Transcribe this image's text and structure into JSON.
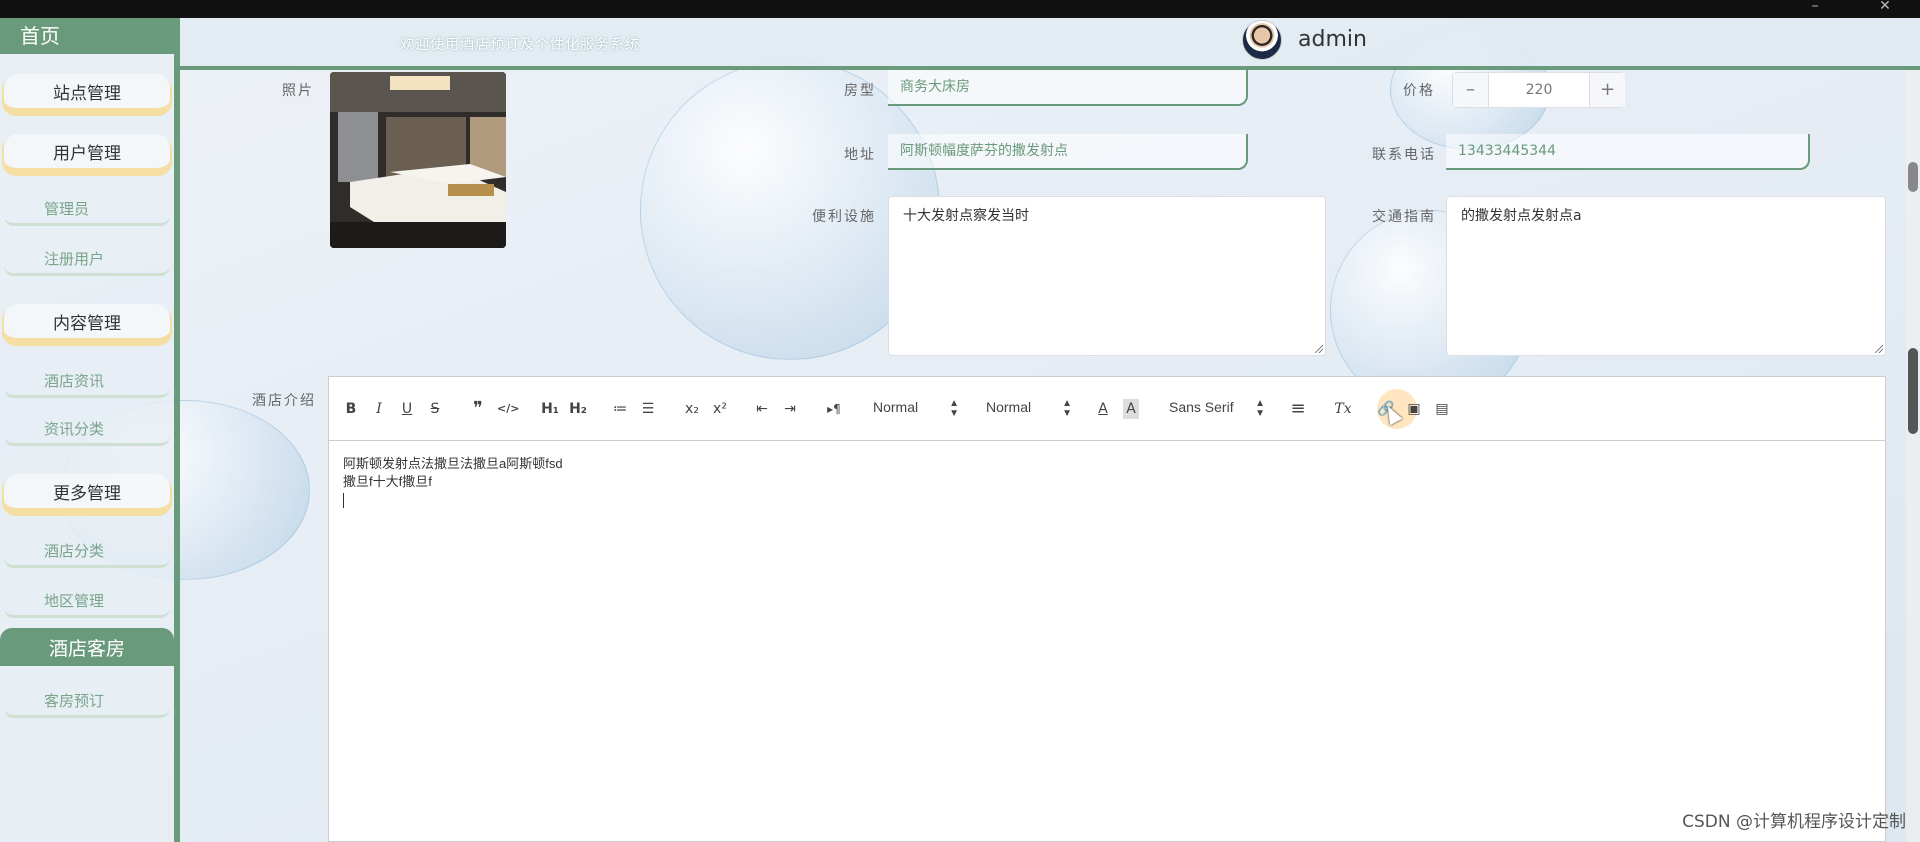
{
  "window": {
    "minimize_label": "–",
    "close_label": "✕"
  },
  "header": {
    "welcome": "欢迎使用酒店预订及个性化服务系统",
    "username": "admin",
    "avatar_icon": "user-avatar"
  },
  "sidebar": {
    "home": "首页",
    "groups": [
      {
        "title": "站点管理",
        "items": []
      },
      {
        "title": "用户管理",
        "items": [
          "管理员",
          "注册用户"
        ]
      },
      {
        "title": "内容管理",
        "items": [
          "酒店资讯",
          "资讯分类"
        ]
      },
      {
        "title": "更多管理",
        "items": [
          "酒店分类",
          "地区管理"
        ]
      }
    ],
    "active_group": {
      "title": "酒店客房",
      "items": [
        "客房预订"
      ]
    }
  },
  "form": {
    "photo_label": "照片",
    "room_type_label": "房型",
    "room_type_value": "商务大床房",
    "price_label": "价格",
    "price_value": "220",
    "address_label": "地址",
    "address_value": "阿斯顿幅度萨芬的撒发射点",
    "phone_label": "联系电话",
    "phone_value": "13433445344",
    "facilities_label": "便利设施",
    "facilities_value": "十大发射点察发当时",
    "transport_label": "交通指南",
    "transport_value": "的撒发射点发射点a",
    "intro_label": "酒店介绍"
  },
  "editor": {
    "toolbar": {
      "bold": "B",
      "italic": "I",
      "underline": "U",
      "strike": "S",
      "blockquote": "❞",
      "code": "</>",
      "h1": "H₁",
      "h2": "H₂",
      "ordered_list": "≔",
      "bullet_list": "☰",
      "subscript": "x₂",
      "superscript": "x²",
      "outdent": "⇤",
      "indent": "⇥",
      "direction": "▸¶",
      "size_select": "Normal",
      "header_select": "Normal",
      "font_select": "Sans Serif",
      "color": "A",
      "background": "A",
      "align": "≡",
      "clean": "Tx"
    },
    "content_lines": [
      "阿斯顿发射点法撒旦法撒旦a阿斯顿fsd",
      "撒旦f十大f撒旦f"
    ]
  },
  "watermark": "CSDN @计算机程序设计定制",
  "colors": {
    "accent_green": "#6a9a7c",
    "accent_yellow": "#f5dea2"
  }
}
